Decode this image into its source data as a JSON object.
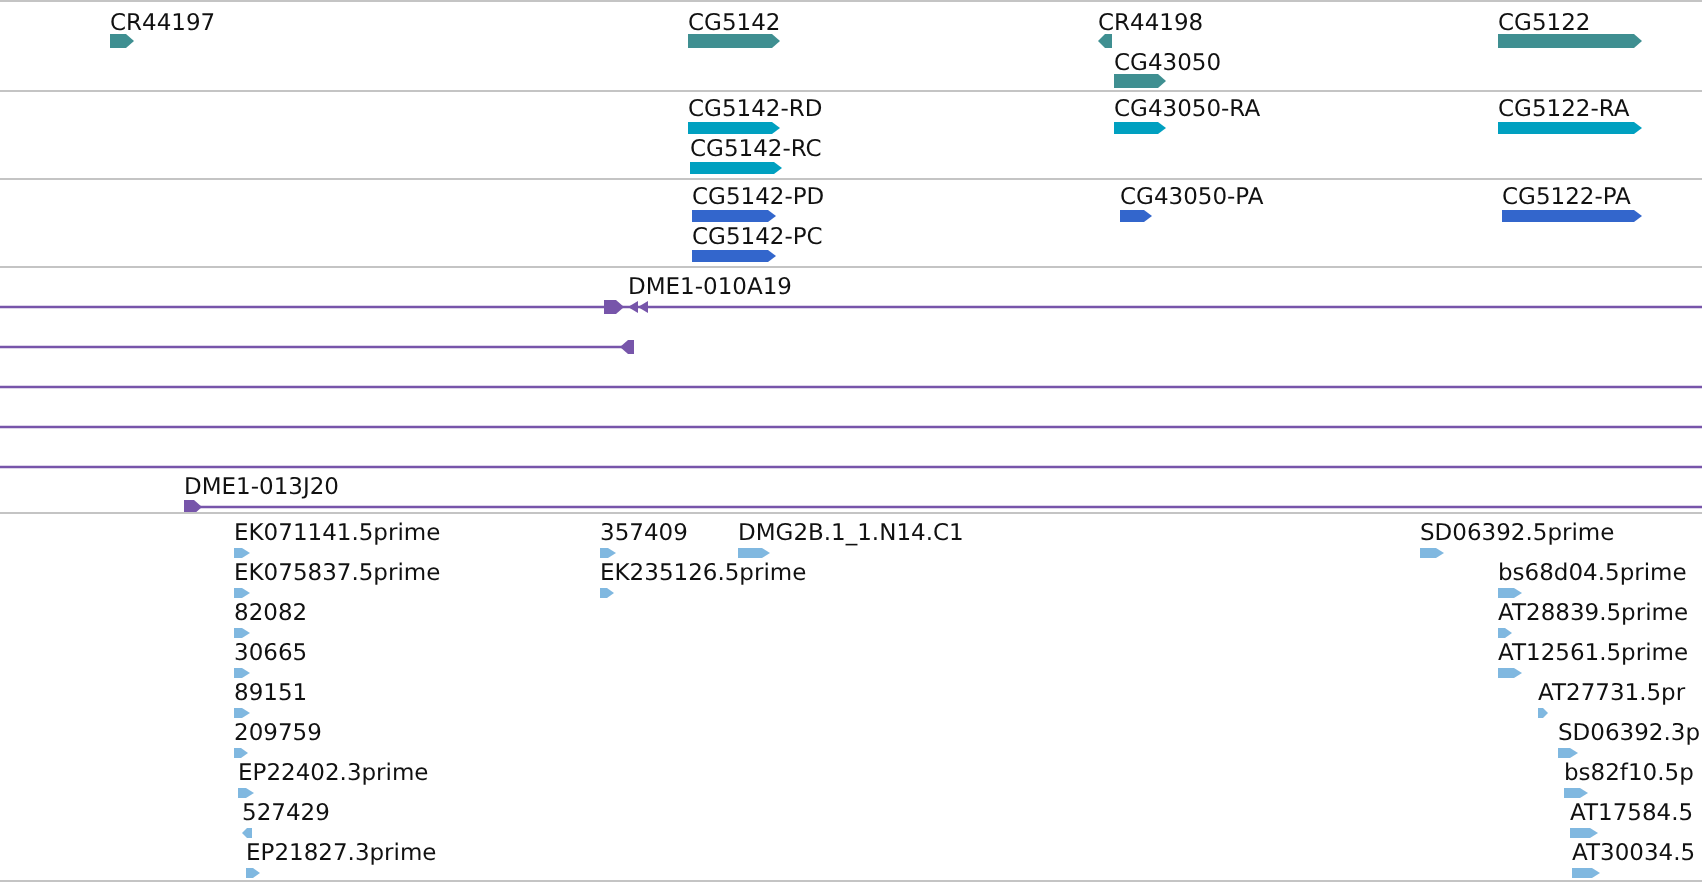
{
  "tracks": [
    {
      "kind": "gene",
      "color": "#3f8f91",
      "features": [
        {
          "label": "CR44197",
          "reverse": false
        },
        {
          "label": "CG5142",
          "reverse": false
        },
        {
          "label": "CR44198",
          "reverse": true
        },
        {
          "label": "CG43050",
          "reverse": false
        },
        {
          "label": "CG5122",
          "reverse": false
        }
      ]
    },
    {
      "kind": "transcript",
      "color": "#00a0c0",
      "features": [
        {
          "label": "CG5142-RD",
          "reverse": false
        },
        {
          "label": "CG5142-RC",
          "reverse": false
        },
        {
          "label": "CG43050-RA",
          "reverse": false
        },
        {
          "label": "CG5122-RA",
          "reverse": false
        }
      ]
    },
    {
      "kind": "transcript",
      "color": "#3366cc",
      "features": [
        {
          "label": "CG5142-PD",
          "reverse": false
        },
        {
          "label": "CG5142-PC",
          "reverse": false
        },
        {
          "label": "CG43050-PA",
          "reverse": false
        },
        {
          "label": "CG5122-PA",
          "reverse": false
        }
      ]
    },
    {
      "kind": "clone",
      "color": "#7755aa",
      "features": [
        {
          "kind": "end-pair",
          "label": "DME1-010A19"
        },
        {
          "kind": "end-reverse"
        },
        {
          "kind": "span"
        },
        {
          "kind": "span"
        },
        {
          "kind": "span"
        },
        {
          "kind": "end-forward",
          "label": "DME1-013J20"
        }
      ]
    },
    {
      "kind": "est",
      "color": "#80b8e0",
      "features": [
        {
          "label": "EK071141.5prime",
          "reverse": false
        },
        {
          "label": "EK075837.5prime",
          "reverse": false
        },
        {
          "label": "82082",
          "reverse": false
        },
        {
          "label": "30665",
          "reverse": false
        },
        {
          "label": "89151",
          "reverse": false
        },
        {
          "label": "209759",
          "reverse": false
        },
        {
          "label": "EP22402.3prime",
          "reverse": false
        },
        {
          "label": "527429",
          "reverse": true
        },
        {
          "label": "EP21827.3prime",
          "reverse": false
        },
        {
          "label": "357409",
          "reverse": false
        },
        {
          "label": "EK235126.5prime",
          "reverse": false
        },
        {
          "label": "DMG2B.1_1.N14.C1",
          "reverse": false
        },
        {
          "label": "SD06392.5prime",
          "reverse": false
        },
        {
          "label": "bs68d04.5prime",
          "reverse": false
        },
        {
          "label": "AT28839.5prime",
          "reverse": false
        },
        {
          "label": "AT12561.5prime",
          "reverse": false
        },
        {
          "label": "AT27731.5pr",
          "reverse": false
        },
        {
          "label": "SD06392.3p",
          "reverse": false
        },
        {
          "label": "bs82f10.5p",
          "reverse": false
        },
        {
          "label": "AT17584.5",
          "reverse": false
        },
        {
          "label": "AT30034.5",
          "reverse": false
        }
      ]
    }
  ]
}
